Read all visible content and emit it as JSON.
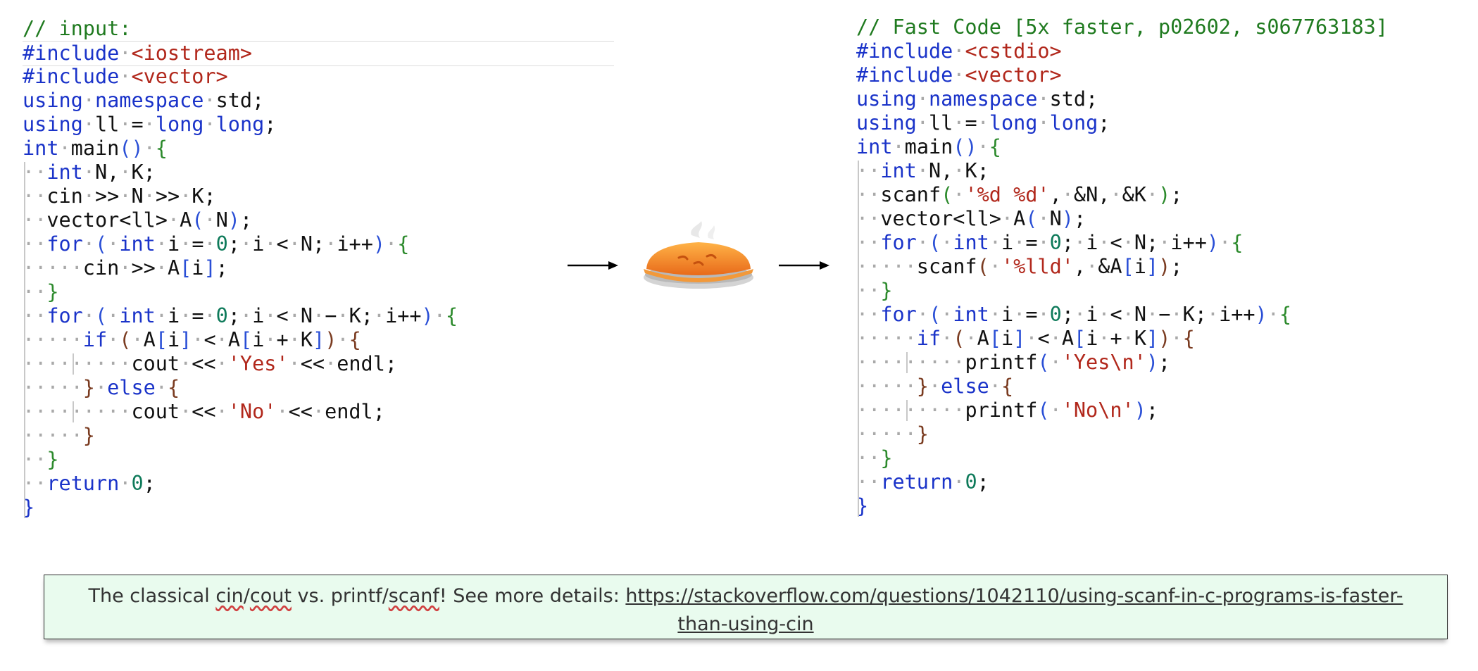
{
  "left_code": {
    "lines": [
      [
        [
          "comment",
          "// input:"
        ]
      ],
      [
        [
          "keyword",
          "#include"
        ],
        [
          "string",
          "<iostream>"
        ]
      ],
      [
        [
          "keyword",
          "#include"
        ],
        [
          "string",
          "<vector>"
        ]
      ],
      [
        [
          "keyword",
          "using"
        ],
        [
          "keyword",
          "namespace"
        ],
        [
          "plain",
          "std;"
        ]
      ],
      [
        [
          "keyword",
          "using"
        ],
        [
          "plain",
          "ll"
        ],
        [
          "plain",
          "="
        ],
        [
          "keyword",
          "long"
        ],
        [
          "keyword",
          "long"
        ],
        [
          "plain",
          ";"
        ]
      ],
      [
        [
          "keyword",
          "int"
        ],
        [
          "plain",
          "main"
        ],
        [
          "paren",
          "()"
        ],
        [
          "brace1",
          "{"
        ]
      ],
      [
        [
          "keyword",
          "int"
        ],
        [
          "plain",
          "N,"
        ],
        [
          "plain",
          "K;"
        ]
      ],
      [
        [
          "plain",
          "cin"
        ],
        [
          "plain",
          ">>"
        ],
        [
          "plain",
          "N"
        ],
        [
          "plain",
          ">>"
        ],
        [
          "plain",
          "K;"
        ]
      ],
      [
        [
          "plain",
          "vector<ll>"
        ],
        [
          "plain",
          "A"
        ],
        [
          "paren",
          "("
        ],
        [
          "plain",
          "N"
        ],
        [
          "paren",
          ")"
        ],
        [
          "plain",
          ";"
        ]
      ],
      [
        [
          "keyword",
          "for"
        ],
        [
          "paren",
          "("
        ],
        [
          "keyword",
          "int"
        ],
        [
          "plain",
          "i"
        ],
        [
          "plain",
          "="
        ],
        [
          "number",
          "0"
        ],
        [
          "plain",
          ";"
        ],
        [
          "plain",
          "i"
        ],
        [
          "plain",
          "<"
        ],
        [
          "plain",
          "N;"
        ],
        [
          "plain",
          "i++"
        ],
        [
          "paren",
          ")"
        ],
        [
          "brace1",
          "{"
        ]
      ],
      [
        [
          "plain",
          "cin"
        ],
        [
          "plain",
          ">>"
        ],
        [
          "plain",
          "A"
        ],
        [
          "bracket",
          "["
        ],
        [
          "plain",
          "i"
        ],
        [
          "bracket",
          "]"
        ],
        [
          "plain",
          ";"
        ]
      ],
      [
        [
          "brace1",
          "}"
        ]
      ],
      [
        [
          "keyword",
          "for"
        ],
        [
          "paren",
          "("
        ],
        [
          "keyword",
          "int"
        ],
        [
          "plain",
          "i"
        ],
        [
          "plain",
          "="
        ],
        [
          "number",
          "0"
        ],
        [
          "plain",
          ";"
        ],
        [
          "plain",
          "i"
        ],
        [
          "plain",
          "<"
        ],
        [
          "plain",
          "N"
        ],
        [
          "plain",
          "−"
        ],
        [
          "plain",
          "K;"
        ],
        [
          "plain",
          "i++"
        ],
        [
          "paren",
          ")"
        ],
        [
          "brace1",
          "{"
        ]
      ],
      [
        [
          "keyword",
          "if"
        ],
        [
          "brace2",
          "("
        ],
        [
          "plain",
          "A"
        ],
        [
          "bracket",
          "["
        ],
        [
          "plain",
          "i"
        ],
        [
          "bracket",
          "]"
        ],
        [
          "plain",
          "<"
        ],
        [
          "plain",
          "A"
        ],
        [
          "bracket",
          "["
        ],
        [
          "plain",
          "i"
        ],
        [
          "plain",
          "+"
        ],
        [
          "plain",
          "K"
        ],
        [
          "bracket",
          "]"
        ],
        [
          "brace2",
          ")"
        ],
        [
          "brace2",
          "{"
        ]
      ],
      [
        [
          "plain",
          "cout"
        ],
        [
          "plain",
          "<<"
        ],
        [
          "string",
          "'Yes'"
        ],
        [
          "plain",
          "<<"
        ],
        [
          "plain",
          "endl;"
        ]
      ],
      [
        [
          "brace2",
          "}"
        ],
        [
          "keyword",
          "else"
        ],
        [
          "brace2",
          "{"
        ]
      ],
      [
        [
          "plain",
          "cout"
        ],
        [
          "plain",
          "<<"
        ],
        [
          "string",
          "'No'"
        ],
        [
          "plain",
          "<<"
        ],
        [
          "plain",
          "endl;"
        ]
      ],
      [
        [
          "brace2",
          "}"
        ]
      ],
      [
        [
          "brace1",
          "}"
        ]
      ],
      [
        [
          "keyword",
          "return"
        ],
        [
          "number",
          "0"
        ],
        [
          "plain",
          ";"
        ]
      ],
      [
        [
          "keyword",
          "}"
        ]
      ]
    ]
  },
  "right_code": {
    "lines": [
      [
        [
          "comment",
          "// Fast Code [5x faster, p02602, s067763183]"
        ]
      ],
      [
        [
          "keyword",
          "#include"
        ],
        [
          "string",
          "<cstdio>"
        ]
      ],
      [
        [
          "keyword",
          "#include"
        ],
        [
          "string",
          "<vector>"
        ]
      ],
      [
        [
          "keyword",
          "using"
        ],
        [
          "keyword",
          "namespace"
        ],
        [
          "plain",
          "std;"
        ]
      ],
      [
        [
          "keyword",
          "using"
        ],
        [
          "plain",
          "ll"
        ],
        [
          "plain",
          "="
        ],
        [
          "keyword",
          "long"
        ],
        [
          "keyword",
          "long"
        ],
        [
          "plain",
          ";"
        ]
      ],
      [
        [
          "keyword",
          "int"
        ],
        [
          "plain",
          "main"
        ],
        [
          "paren",
          "()"
        ],
        [
          "brace1",
          "{"
        ]
      ],
      [
        [
          "keyword",
          "int"
        ],
        [
          "plain",
          "N,"
        ],
        [
          "plain",
          "K;"
        ]
      ],
      [
        [
          "plain",
          "scanf"
        ],
        [
          "brace1",
          "("
        ],
        [
          "string",
          "'%d %d'"
        ],
        [
          "plain",
          ","
        ],
        [
          "plain",
          "&N,"
        ],
        [
          "plain",
          "&K"
        ],
        [
          "brace1",
          ")"
        ],
        [
          "plain",
          ";"
        ]
      ],
      [
        [
          "plain",
          "vector<ll>"
        ],
        [
          "plain",
          "A"
        ],
        [
          "paren",
          "("
        ],
        [
          "plain",
          "N"
        ],
        [
          "paren",
          ")"
        ],
        [
          "plain",
          ";"
        ]
      ],
      [
        [
          "keyword",
          "for"
        ],
        [
          "paren",
          "("
        ],
        [
          "keyword",
          "int"
        ],
        [
          "plain",
          "i"
        ],
        [
          "plain",
          "="
        ],
        [
          "number",
          "0"
        ],
        [
          "plain",
          ";"
        ],
        [
          "plain",
          "i"
        ],
        [
          "plain",
          "<"
        ],
        [
          "plain",
          "N;"
        ],
        [
          "plain",
          "i++"
        ],
        [
          "paren",
          ")"
        ],
        [
          "brace1",
          "{"
        ]
      ],
      [
        [
          "plain",
          "scanf"
        ],
        [
          "brace2",
          "("
        ],
        [
          "string",
          "'%lld'"
        ],
        [
          "plain",
          ","
        ],
        [
          "plain",
          "&A"
        ],
        [
          "bracket",
          "["
        ],
        [
          "plain",
          "i"
        ],
        [
          "bracket",
          "]"
        ],
        [
          "brace2",
          ")"
        ],
        [
          "plain",
          ";"
        ]
      ],
      [
        [
          "brace1",
          "}"
        ]
      ],
      [
        [
          "keyword",
          "for"
        ],
        [
          "paren",
          "("
        ],
        [
          "keyword",
          "int"
        ],
        [
          "plain",
          "i"
        ],
        [
          "plain",
          "="
        ],
        [
          "number",
          "0"
        ],
        [
          "plain",
          ";"
        ],
        [
          "plain",
          "i"
        ],
        [
          "plain",
          "<"
        ],
        [
          "plain",
          "N"
        ],
        [
          "plain",
          "−"
        ],
        [
          "plain",
          "K;"
        ],
        [
          "plain",
          "i++"
        ],
        [
          "paren",
          ")"
        ],
        [
          "brace1",
          "{"
        ]
      ],
      [
        [
          "keyword",
          "if"
        ],
        [
          "brace2",
          "("
        ],
        [
          "plain",
          "A"
        ],
        [
          "bracket",
          "["
        ],
        [
          "plain",
          "i"
        ],
        [
          "bracket",
          "]"
        ],
        [
          "plain",
          "<"
        ],
        [
          "plain",
          "A"
        ],
        [
          "bracket",
          "["
        ],
        [
          "plain",
          "i"
        ],
        [
          "plain",
          "+"
        ],
        [
          "plain",
          "K"
        ],
        [
          "bracket",
          "]"
        ],
        [
          "brace2",
          ")"
        ],
        [
          "brace2",
          "{"
        ]
      ],
      [
        [
          "plain",
          "printf"
        ],
        [
          "paren",
          "("
        ],
        [
          "string",
          "'Yes\\n'"
        ],
        [
          "paren",
          ")"
        ],
        [
          "plain",
          ";"
        ]
      ],
      [
        [
          "brace2",
          "}"
        ],
        [
          "keyword",
          "else"
        ],
        [
          "brace2",
          "{"
        ]
      ],
      [
        [
          "plain",
          "printf"
        ],
        [
          "paren",
          "("
        ],
        [
          "string",
          "'No\\n'"
        ],
        [
          "paren",
          ")"
        ],
        [
          "plain",
          ";"
        ]
      ],
      [
        [
          "brace2",
          "}"
        ]
      ],
      [
        [
          "brace1",
          "}"
        ]
      ],
      [
        [
          "keyword",
          "return"
        ],
        [
          "number",
          "0"
        ],
        [
          "plain",
          ";"
        ]
      ],
      [
        [
          "keyword",
          "}"
        ]
      ]
    ]
  },
  "note": {
    "text_before": "The classical ",
    "cin": "cin",
    "slash1": "/",
    "cout": "cout",
    "mid": " vs. printf/",
    "scanf": "scanf",
    "after": "! See more details: ",
    "link": "https://stackoverflow.com/questions/1042110/using-scanf-in-c-programs-is-faster-than-using-cin"
  },
  "icons": {
    "center": "pie-icon"
  },
  "colors": {
    "comment": "#1f7a1f",
    "keyword": "#1a33c9",
    "string": "#b1271b",
    "number": "#0e7a5a",
    "note_background": "#e9fbee"
  }
}
